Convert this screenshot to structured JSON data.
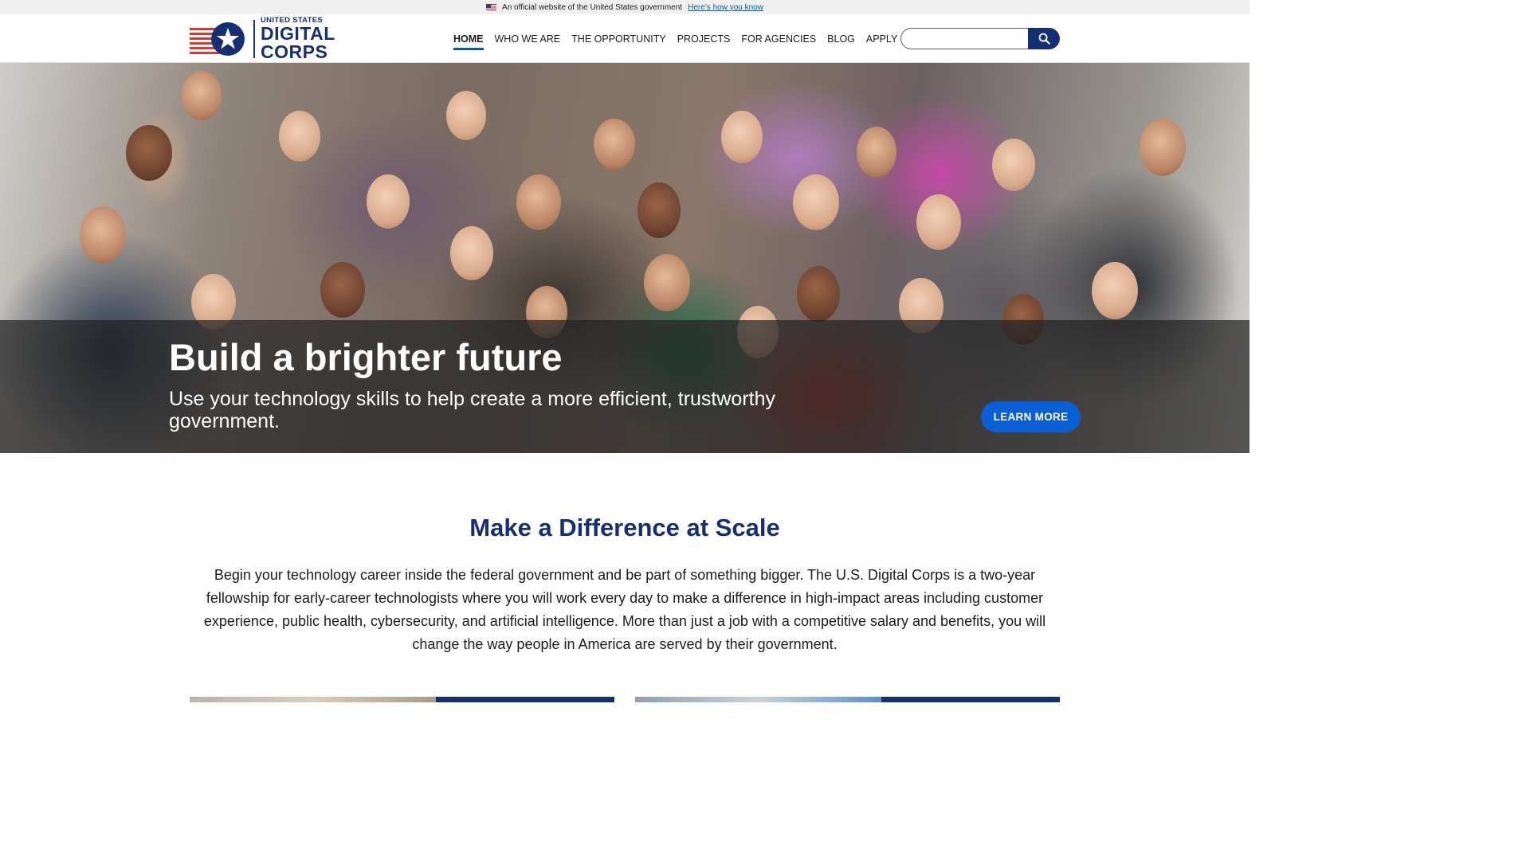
{
  "gov_banner": {
    "text": "An official website of the United States government",
    "link": "Here’s how you know"
  },
  "header": {
    "logo": {
      "small": "UNITED STATES",
      "line1": "DIGITAL",
      "line2": "CORPS"
    },
    "nav": [
      {
        "label": "HOME",
        "active": true
      },
      {
        "label": "WHO WE ARE",
        "active": false
      },
      {
        "label": "THE OPPORTUNITY",
        "active": false
      },
      {
        "label": "PROJECTS",
        "active": false
      },
      {
        "label": "FOR AGENCIES",
        "active": false
      },
      {
        "label": "BLOG",
        "active": false
      },
      {
        "label": "APPLY",
        "active": false
      }
    ],
    "search": {
      "value": "",
      "icon": "search-icon"
    }
  },
  "hero": {
    "title": "Build a brighter future",
    "subtitle": "Use your technology skills to help create a more efficient, trustworthy government.",
    "button": "LEARN MORE"
  },
  "main": {
    "title": "Make a Difference at Scale",
    "body": "Begin your technology career inside the federal government and be part of something bigger. The U.S. Digital Corps is a two-year fellowship for early-career technologists where you will work every day to make a difference in high-impact areas including customer experience, public health, cybersecurity, and artificial intelligence. More than just a job with a competitive salary and benefits, you will change the way people in America are served by their government."
  },
  "colors": {
    "brand_navy": "#162e73",
    "brand_red": "#d83933",
    "accent_blue": "#0b5fd6",
    "link_blue": "#005ea2"
  }
}
